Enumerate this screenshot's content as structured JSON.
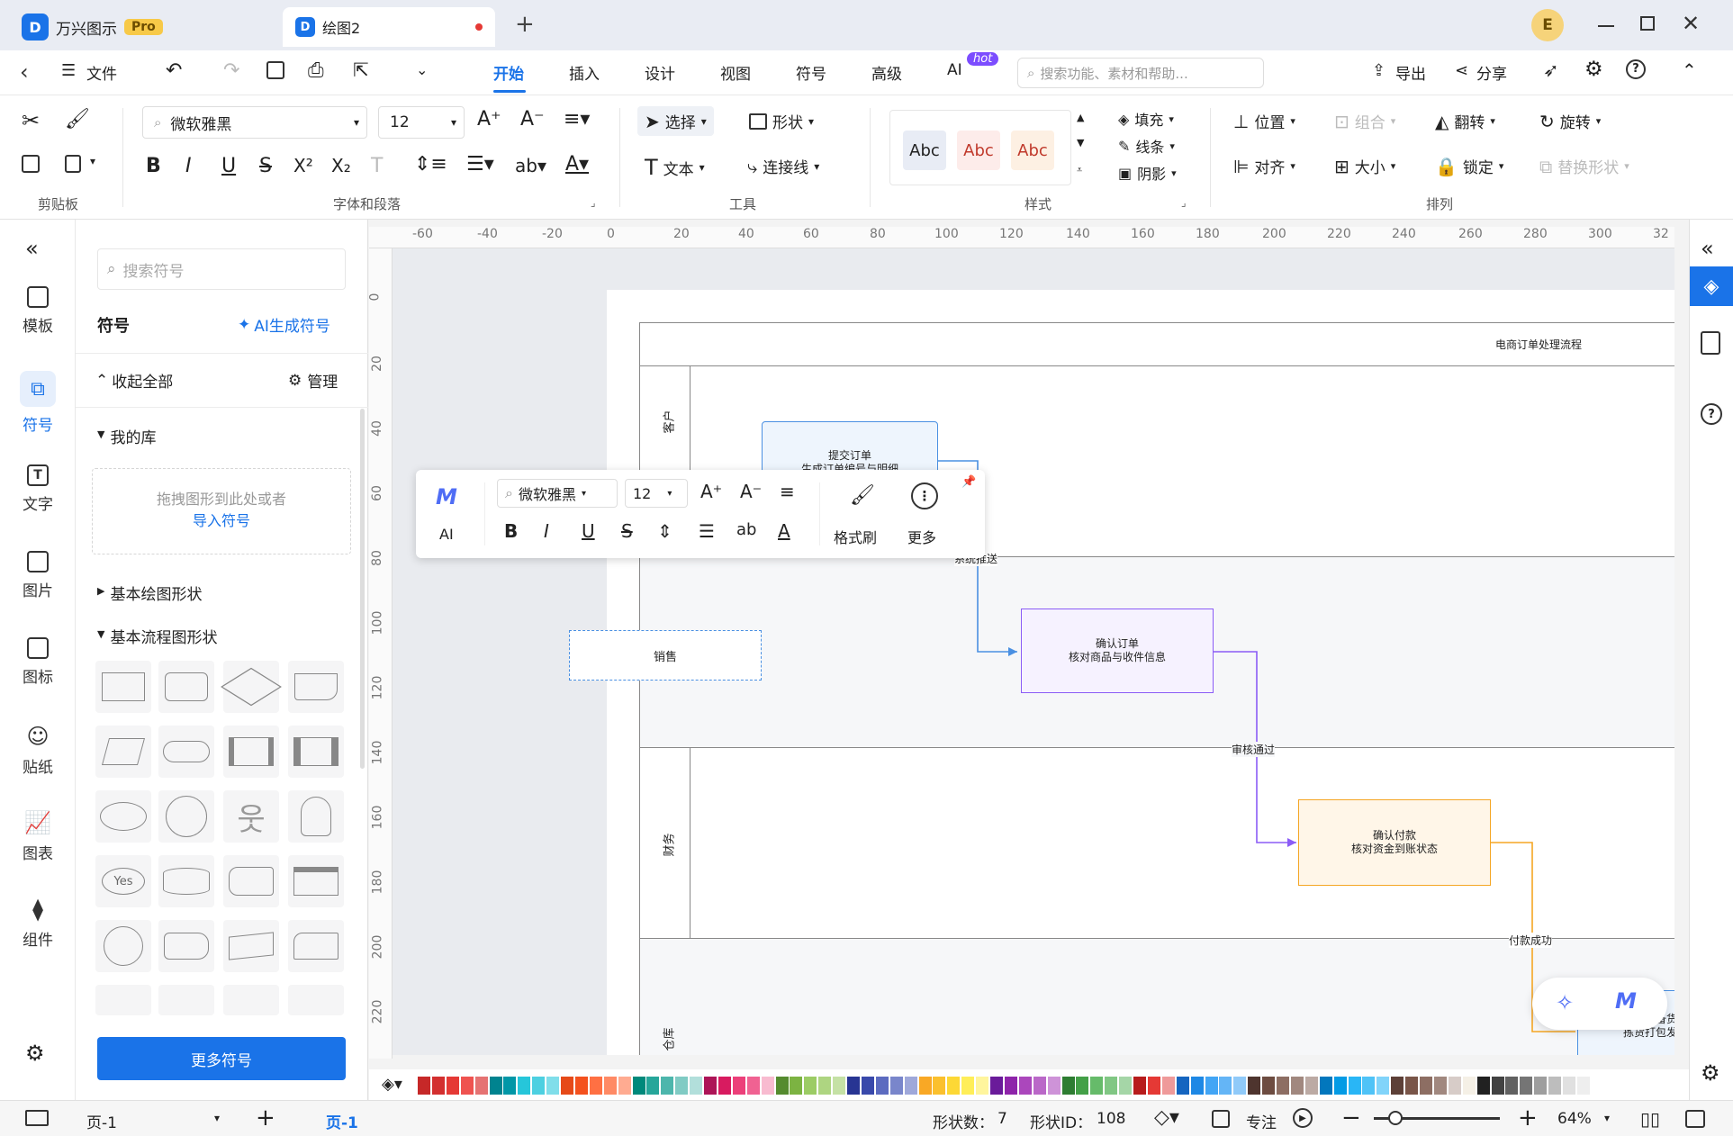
{
  "titlebar": {
    "app_name": "万兴图示",
    "pro_badge": "Pro",
    "doc_tab": "绘图2",
    "new_tab": "+",
    "avatar_letter": "E"
  },
  "menubar": {
    "back": "<",
    "file": "文件",
    "tabs": [
      "开始",
      "插入",
      "设计",
      "视图",
      "符号",
      "高级",
      "AI"
    ],
    "active_tab": "开始",
    "ai_badge": "hot",
    "search_placeholder": "搜索功能、素材和帮助...",
    "export": "导出",
    "share": "分享"
  },
  "ribbon": {
    "font_name": "微软雅黑",
    "font_size": "12",
    "select": "选择",
    "shape": "形状",
    "text": "文本",
    "connector": "连接线",
    "style_abc": [
      "Abc",
      "Abc",
      "Abc"
    ],
    "fill": "填充",
    "line": "线条",
    "shadow": "阴影",
    "position": "位置",
    "group": "组合",
    "flip": "翻转",
    "rotate": "旋转",
    "align": "对齐",
    "size": "大小",
    "lock": "锁定",
    "replace_shape": "替换形状",
    "groups": [
      "剪贴板",
      "字体和段落",
      "工具",
      "样式",
      "排列"
    ],
    "format_buttons": [
      "B",
      "I",
      "U",
      "S",
      "X²",
      "X₂",
      "T"
    ]
  },
  "leftrail": {
    "items": [
      "模板",
      "符号",
      "文字",
      "图片",
      "图标",
      "贴纸",
      "图表",
      "组件"
    ],
    "active": "符号"
  },
  "symbolpanel": {
    "search_placeholder": "搜索符号",
    "title": "符号",
    "ai_generate": "AI生成符号",
    "collapse_all": "收起全部",
    "manage": "管理",
    "my_library": "我的库",
    "drop_hint": "拖拽图形到此处或者",
    "import_link": "导入符号",
    "basic_drawing": "基本绘图形状",
    "basic_flow": "基本流程图形状",
    "yes_label": "Yes",
    "more_symbols": "更多符号"
  },
  "rulers": {
    "h_ticks": [
      "-60",
      "-40",
      "-20",
      "0",
      "20",
      "40",
      "60",
      "80",
      "100",
      "120",
      "140",
      "160",
      "180",
      "200",
      "220",
      "240",
      "260",
      "280",
      "300",
      "32"
    ],
    "v_ticks": [
      "0",
      "20",
      "40",
      "60",
      "80",
      "100",
      "120",
      "140",
      "160",
      "180",
      "200",
      "220"
    ]
  },
  "diagram": {
    "title": "电商订单处理流程",
    "lanes": [
      "客户",
      "",
      "财务",
      "仓库"
    ],
    "floating_box": "销售",
    "node1_title": "提交订单",
    "node1_sub": "生成订单编号与明细",
    "node2_title": "确认订单",
    "node2_sub": "核对商品与收件信息",
    "node3_title": "确认付款",
    "node3_sub": "核对资金到账状态",
    "node4_title": "备货",
    "node4_sub": "拣货打包发",
    "edge1": "系统推送",
    "edge2": "审核通过",
    "edge3": "付款成功"
  },
  "floatbar": {
    "ai": "AI",
    "font_name": "微软雅黑",
    "font_size": "12",
    "format_painter": "格式刷",
    "more": "更多"
  },
  "statusbar": {
    "page_selector": "页-1",
    "page_tab": "页-1",
    "shape_count_label": "形状数：",
    "shape_count": "7",
    "shape_id_label": "形状ID：",
    "shape_id": "108",
    "focus": "专注",
    "zoom": "64%"
  },
  "colors": {
    "accent": "#1a73e8",
    "node2_border": "#8b5cf6",
    "node3_border": "#f5a623",
    "node1_border": "#4a90e2"
  }
}
